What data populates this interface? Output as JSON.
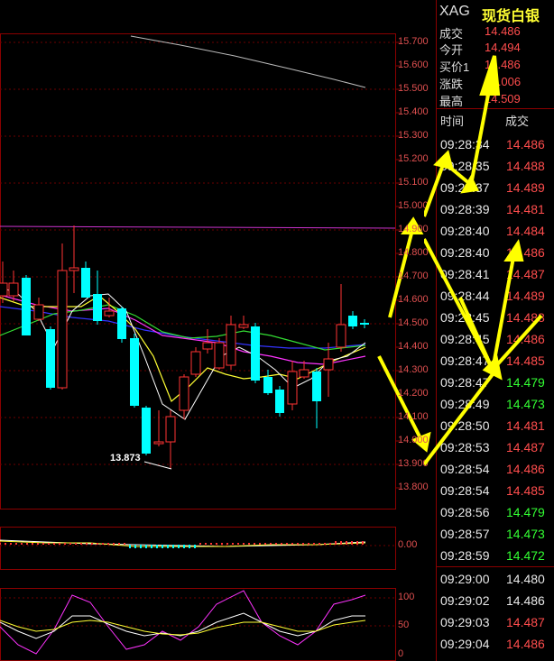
{
  "header": {
    "symbol": "XAG",
    "name": "现货白银"
  },
  "quote": [
    {
      "label": "成交",
      "value": "14.486"
    },
    {
      "label": "今开",
      "value": "14.494"
    },
    {
      "label": "买价1",
      "value": "14.486"
    },
    {
      "label": "涨跌",
      "value": "+0.006"
    },
    {
      "label": "最高",
      "value": "14.509"
    }
  ],
  "trade_headers": {
    "time": "时间",
    "price": "成交"
  },
  "trades": [
    {
      "time": "09:28:34",
      "price": "14.486",
      "color": "#ff4d4d"
    },
    {
      "time": "09:28:35",
      "price": "14.488",
      "color": "#ff4d4d"
    },
    {
      "time": "09:28:37",
      "price": "14.489",
      "color": "#ff4d4d"
    },
    {
      "time": "09:28:39",
      "price": "14.481",
      "color": "#ff4d4d"
    },
    {
      "time": "09:28:40",
      "price": "14.484",
      "color": "#ff4d4d"
    },
    {
      "time": "09:28:40",
      "price": "14.486",
      "color": "#ff4d4d"
    },
    {
      "time": "09:28:41",
      "price": "14.487",
      "color": "#ff4d4d"
    },
    {
      "time": "09:28:44",
      "price": "14.489",
      "color": "#ff4d4d"
    },
    {
      "time": "09:28:45",
      "price": "14.488",
      "color": "#ff4d4d"
    },
    {
      "time": "09:28:45",
      "price": "14.486",
      "color": "#ff4d4d"
    },
    {
      "time": "09:28:47",
      "price": "14.485",
      "color": "#ff4d4d"
    },
    {
      "time": "09:28:47",
      "price": "14.479",
      "color": "#33ff33"
    },
    {
      "time": "09:28:49",
      "price": "14.473",
      "color": "#33ff33"
    },
    {
      "time": "09:28:50",
      "price": "14.481",
      "color": "#ff4d4d"
    },
    {
      "time": "09:28:53",
      "price": "14.487",
      "color": "#ff4d4d"
    },
    {
      "time": "09:28:54",
      "price": "14.486",
      "color": "#ff4d4d"
    },
    {
      "time": "09:28:54",
      "price": "14.485",
      "color": "#ff4d4d"
    },
    {
      "time": "09:28:56",
      "price": "14.479",
      "color": "#33ff33"
    },
    {
      "time": "09:28:57",
      "price": "14.473",
      "color": "#33ff33"
    },
    {
      "time": "09:28:59",
      "price": "14.472",
      "color": "#33ff33"
    },
    {
      "time": "09:29:00",
      "price": "14.480",
      "color": "#e8e8e8"
    },
    {
      "time": "09:29:02",
      "price": "14.486",
      "color": "#e8e8e8"
    },
    {
      "time": "09:29:03",
      "price": "14.487",
      "color": "#ff4d4d"
    },
    {
      "time": "09:29:04",
      "price": "14.486",
      "color": "#ff4d4d"
    }
  ],
  "price_axis": {
    "labels": [
      "15.700",
      "15.600",
      "15.500",
      "15.400",
      "15.300",
      "15.200",
      "15.100",
      "15.000",
      "14.900",
      "14.800",
      "14.700",
      "14.600",
      "14.500",
      "14.400",
      "14.300",
      "14.200",
      "14.100",
      "14.000",
      "13.900",
      "13.800"
    ],
    "min": 13.8,
    "max": 15.7
  },
  "low_marker": "13.873",
  "macd_axis": {
    "label": "0.00"
  },
  "kdj_axis": {
    "labels": [
      "100",
      "50",
      "0"
    ]
  },
  "colors": {
    "up": "#ff3333",
    "down": "#00ffff",
    "grid": "#8b0000",
    "axis_text": "#e05050",
    "arrow": "#ffff00"
  }
}
